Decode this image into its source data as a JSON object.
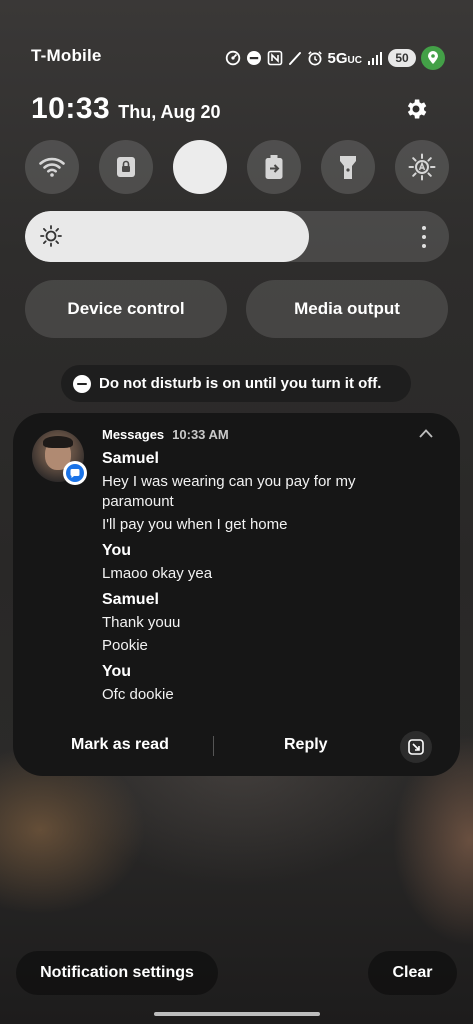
{
  "status_bar": {
    "carrier": "T-Mobile",
    "network": "5G",
    "network_suffix": "UC",
    "battery": "50",
    "icons": [
      "data-saver-icon",
      "dnd-icon",
      "nfc-icon",
      "stylus-icon",
      "alarm-icon",
      "signal-icon",
      "battery-icon",
      "location-icon"
    ]
  },
  "header": {
    "time": "10:33",
    "date": "Thu, Aug 20"
  },
  "quick_toggles": [
    {
      "name": "wifi",
      "active": false
    },
    {
      "name": "lock",
      "active": false
    },
    {
      "name": "do-not-disturb",
      "active": true
    },
    {
      "name": "power-share",
      "active": false
    },
    {
      "name": "flashlight",
      "active": false
    },
    {
      "name": "auto-brightness",
      "active": false
    }
  ],
  "brightness": {
    "level": 0.67
  },
  "controls": {
    "device_control": "Device control",
    "media_output": "Media output"
  },
  "dnd_banner": {
    "text": "Do not disturb is on until you turn it off."
  },
  "notification": {
    "app": "Messages",
    "time": "10:33 AM",
    "conversation": [
      {
        "sender": "Samuel",
        "lines": [
          "Hey I was wearing can you pay for my paramount",
          "I'll pay you when I get home"
        ]
      },
      {
        "sender": "You",
        "lines": [
          "Lmaoo okay yea"
        ]
      },
      {
        "sender": "Samuel",
        "lines": [
          "Thank youu",
          "Pookie"
        ]
      },
      {
        "sender": "You",
        "lines": [
          "Ofc dookie"
        ]
      }
    ],
    "actions": {
      "mark_read": "Mark as read",
      "reply": "Reply"
    }
  },
  "bottom": {
    "notification_settings": "Notification settings",
    "clear": "Clear"
  },
  "colors": {
    "toggle_active": "#ececec",
    "location_badge": "#43a047",
    "card_bg": "#161616"
  }
}
